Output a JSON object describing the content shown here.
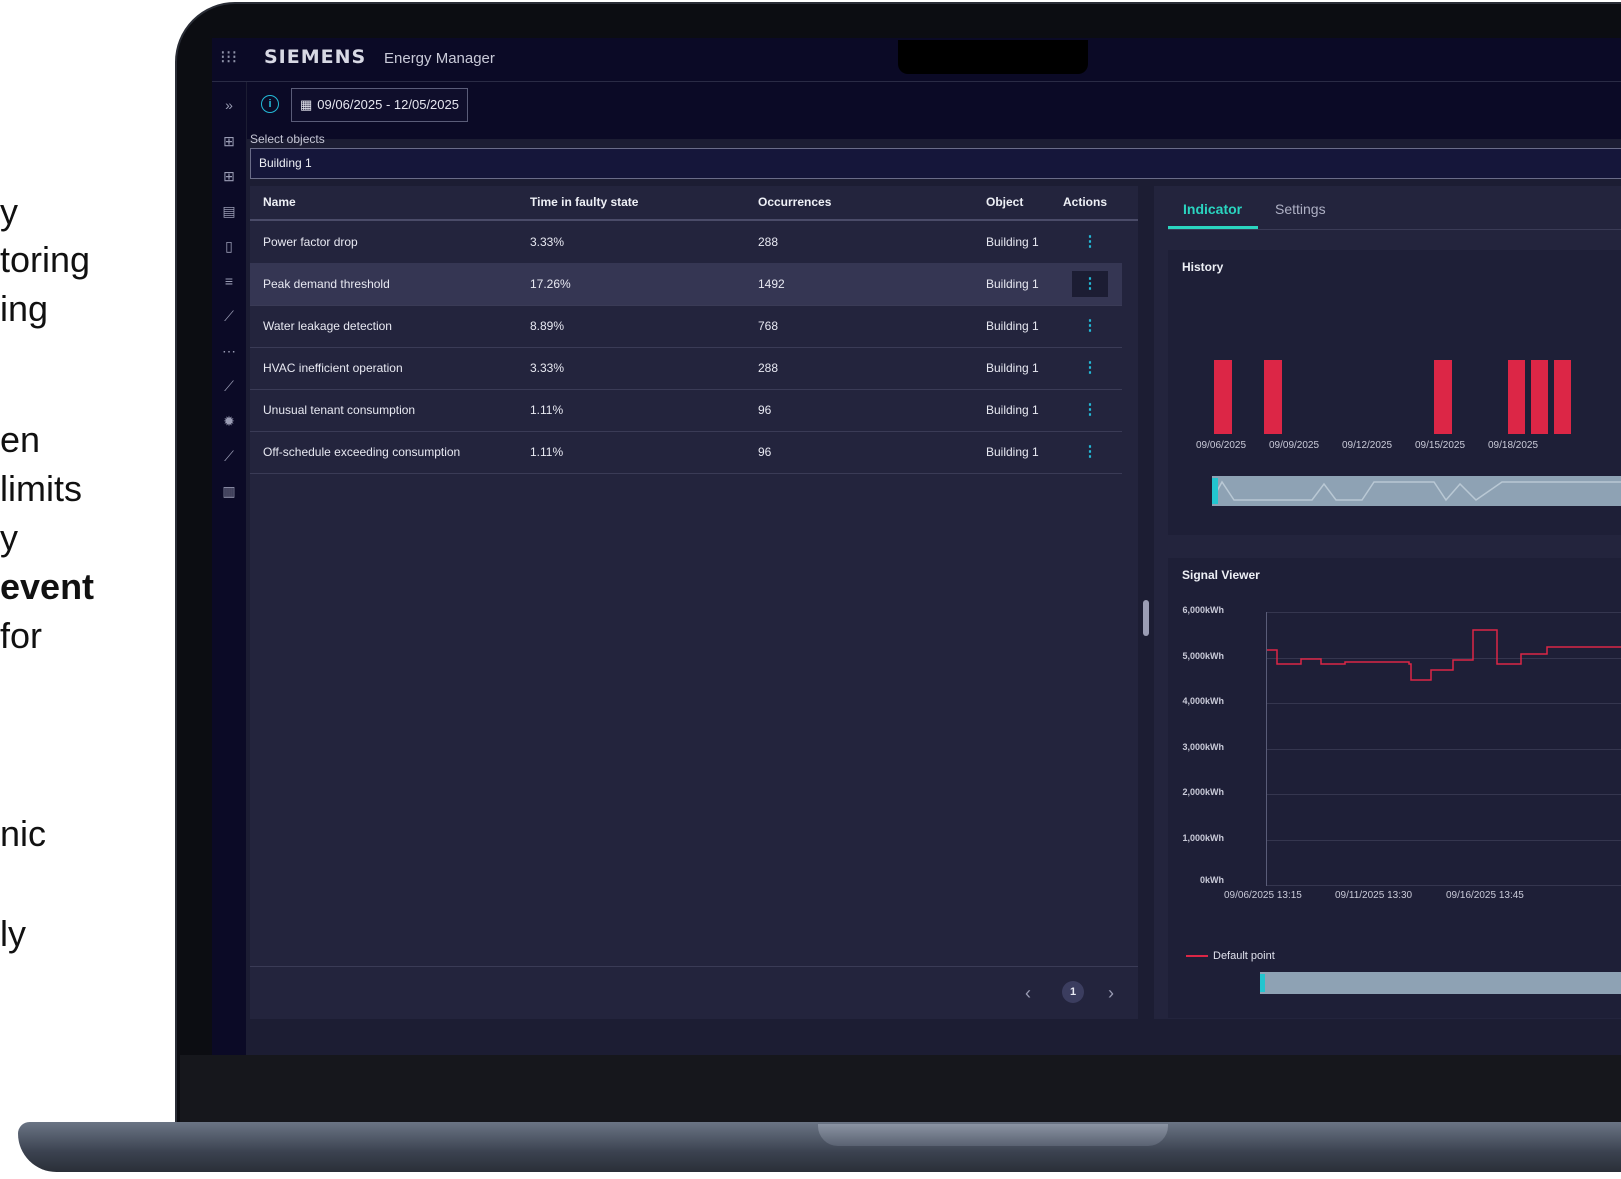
{
  "left_fragments": [
    {
      "text": "y",
      "bold": false
    },
    {
      "text": "toring",
      "bold": false
    },
    {
      "text": "ing",
      "bold": false
    },
    {
      "text": "en",
      "bold": false
    },
    {
      "text": " limits",
      "bold": false
    },
    {
      "text": "y",
      "bold": false
    },
    {
      "text": "event",
      "bold": true
    },
    {
      "text": "for",
      "bold": false
    },
    {
      "text": "nic",
      "bold": false
    },
    {
      "text": "ly",
      "bold": false
    }
  ],
  "header": {
    "brand": "SIEMENS",
    "app_name": "Energy Manager"
  },
  "toolbar": {
    "date_range": "09/06/2025 - 12/05/2025"
  },
  "selector": {
    "label": "Select objects",
    "value": "Building 1"
  },
  "sidebar_icons": [
    "expand-icon",
    "dashboard-icon",
    "dashboard-alt-icon",
    "report-icon",
    "document-icon",
    "filter-icon",
    "analytics-icon",
    "flow-icon",
    "line-chart-icon",
    "settings-icon",
    "trend-icon",
    "bar-chart-icon"
  ],
  "table": {
    "columns": [
      "Name",
      "Time in faulty state",
      "Occurrences",
      "Object",
      "Actions"
    ],
    "rows": [
      {
        "name": "Power factor drop",
        "time": "3.33%",
        "occurrences": "288",
        "object": "Building 1"
      },
      {
        "name": "Peak demand threshold",
        "time": "17.26%",
        "occurrences": "1492",
        "object": "Building 1"
      },
      {
        "name": "Water leakage detection",
        "time": "8.89%",
        "occurrences": "768",
        "object": "Building 1"
      },
      {
        "name": "HVAC inefficient operation",
        "time": "3.33%",
        "occurrences": "288",
        "object": "Building 1"
      },
      {
        "name": "Unusual tenant consumption",
        "time": "1.11%",
        "occurrences": "96",
        "object": "Building 1"
      },
      {
        "name": "Off-schedule exceeding consumption",
        "time": "1.11%",
        "occurrences": "96",
        "object": "Building 1"
      }
    ],
    "selected_row": 1,
    "kebab": "⋮",
    "page": "1"
  },
  "tabs": [
    "Indicator",
    "Settings"
  ],
  "history": {
    "title": "History",
    "x_labels": [
      "09/06/2025",
      "09/09/2025",
      "09/12/2025",
      "09/15/2025",
      "09/18/2025"
    ]
  },
  "signal": {
    "title": "Signal Viewer",
    "y_labels": [
      "6,000kWh",
      "5,000kWh",
      "4,000kWh",
      "3,000kWh",
      "2,000kWh",
      "1,000kWh",
      "0kWh"
    ],
    "x_labels": [
      "09/06/2025 13:15",
      "09/11/2025 13:30",
      "09/16/2025 13:45"
    ],
    "legend": "Default point"
  },
  "colors": {
    "accent": "#2ad5c0",
    "alarm": "#dc2646",
    "info": "#23b9d6"
  }
}
